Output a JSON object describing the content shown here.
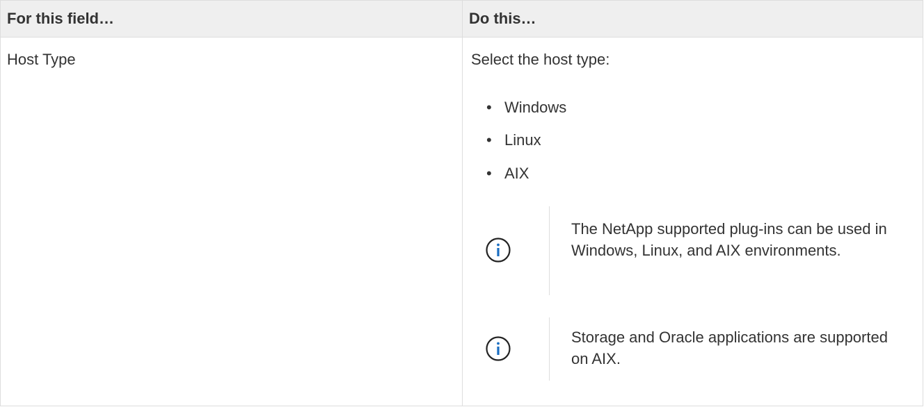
{
  "table": {
    "headers": [
      "For this field…",
      "Do this…"
    ],
    "row": {
      "field": "Host Type",
      "intro": "Select the host type:",
      "options": [
        "Windows",
        "Linux",
        "AIX"
      ],
      "notes": [
        {
          "icon": "info-icon",
          "text": "The NetApp supported plug-ins can be used in Windows, Linux, and AIX environments."
        },
        {
          "icon": "info-icon",
          "text": "Storage and Oracle applications are supported on AIX."
        }
      ]
    }
  },
  "colors": {
    "header_bg": "#efefef",
    "border": "#dddddd",
    "text": "#333333",
    "info_icon": "#1a6ec2"
  }
}
